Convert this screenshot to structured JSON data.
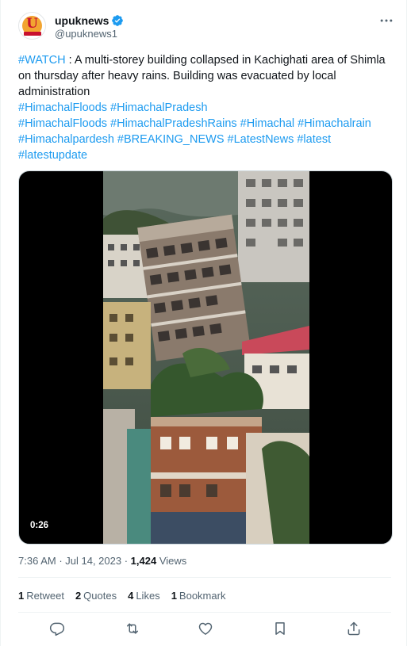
{
  "author": {
    "name": "upuknews",
    "handle": "@upuknews1",
    "avatar_letter": "U",
    "verified_icon": "verified-badge-icon"
  },
  "tweet": {
    "lead_hashtag": "#WATCH",
    "text": " : A multi-storey building collapsed in Kachighati area of Shimla on thursday after heavy rains. Building was evacuated by local administration",
    "hashtags_line1": "#HimachalFloods #HimachalPradesh",
    "hashtags_line2": "#HimachalFloods #HimachalPradeshRains #Himachal #Himachalrain #Himachalpardesh #BREAKING_NEWS #LatestNews #latest #latestupdate"
  },
  "media": {
    "duration": "0:26"
  },
  "meta": {
    "time": "7:36 AM",
    "separator1": " · ",
    "date": "Jul 14, 2023",
    "separator2": " · ",
    "views_count": "1,424",
    "views_label": " Views"
  },
  "stats": {
    "retweets_count": "1",
    "retweets_label": "Retweet",
    "quotes_count": "2",
    "quotes_label": "Quotes",
    "likes_count": "4",
    "likes_label": "Likes",
    "bookmarks_count": "1",
    "bookmarks_label": "Bookmark"
  },
  "actions": [
    "reply-icon",
    "retweet-icon",
    "like-icon",
    "bookmark-icon",
    "share-icon"
  ],
  "colors": {
    "link": "#1d9bf0",
    "text": "#0f1419",
    "secondary": "#536471",
    "verified": "#1d9bf0"
  }
}
